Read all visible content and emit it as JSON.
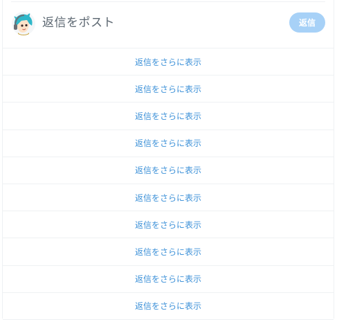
{
  "composer": {
    "placeholder": "返信をポスト",
    "reply_button_label": "返信",
    "avatar_icon": "cartoon-avatar-icon"
  },
  "more_replies": [
    {
      "label": "返信をさらに表示"
    },
    {
      "label": "返信をさらに表示"
    },
    {
      "label": "返信をさらに表示"
    },
    {
      "label": "返信をさらに表示"
    },
    {
      "label": "返信をさらに表示"
    },
    {
      "label": "返信をさらに表示"
    },
    {
      "label": "返信をさらに表示"
    },
    {
      "label": "返信をさらに表示"
    },
    {
      "label": "返信をさらに表示"
    },
    {
      "label": "返信をさらに表示"
    }
  ],
  "colors": {
    "link": "#3d91d8",
    "button_disabled": "#a7d1f7",
    "divider": "#eef1f3",
    "placeholder_text": "#5b6670"
  }
}
